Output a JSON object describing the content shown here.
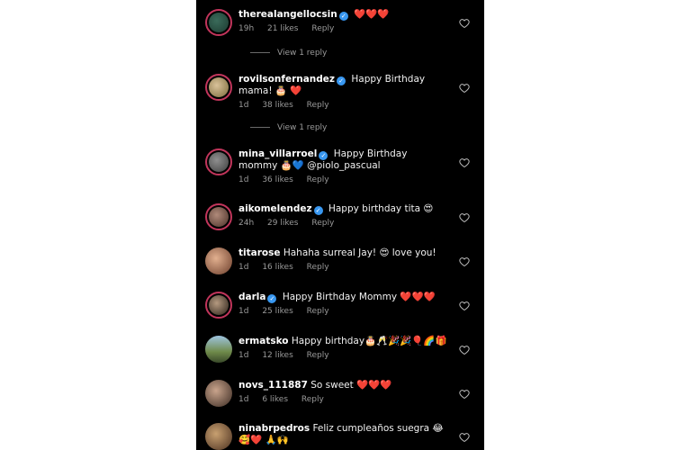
{
  "comments": [
    {
      "username": "therealangellocsin",
      "verified": true,
      "text": "❤️❤️❤️",
      "time": "19h",
      "likes": "21 likes",
      "reply": "Reply"
    },
    {
      "username": "rovilsonfernandez",
      "verified": true,
      "text": "Happy Birthday mama! 🎂 ❤️",
      "time": "1d",
      "likes": "38 likes",
      "reply": "Reply"
    },
    {
      "username": "mina_villarroel",
      "verified": true,
      "text": "Happy Birthday mommy 🎂💙 @piolo_pascual",
      "time": "1d",
      "likes": "36 likes",
      "reply": "Reply"
    },
    {
      "username": "aikomelendez",
      "verified": true,
      "text": "Happy birthday tita 😍",
      "time": "24h",
      "likes": "29 likes",
      "reply": "Reply"
    },
    {
      "username": "titarose",
      "verified": false,
      "text": "Hahaha surreal Jay! 😍 love you!",
      "time": "1d",
      "likes": "16 likes",
      "reply": "Reply"
    },
    {
      "username": "darla",
      "verified": true,
      "text": "Happy Birthday Mommy ❤️❤️❤️",
      "time": "1d",
      "likes": "25 likes",
      "reply": "Reply"
    },
    {
      "username": "ermatsko",
      "verified": false,
      "text": "Happy birthday🎂🥂🎉🎉🎈🌈🎁",
      "time": "1d",
      "likes": "12 likes",
      "reply": "Reply"
    },
    {
      "username": "novs_111887",
      "verified": false,
      "text": "So sweet ❤️❤️❤️",
      "time": "1d",
      "likes": "6 likes",
      "reply": "Reply"
    },
    {
      "username": "ninabrpedros",
      "verified": false,
      "text": "Feliz cumpleaños suegra 😂🥰❤️ 🙏🙌",
      "time": "",
      "likes": "",
      "reply": ""
    }
  ],
  "view_replies": [
    "View 1 reply",
    "View 1 reply"
  ],
  "colors": {
    "background": "#000000",
    "verified": "#3897f0",
    "ring": "#c1355b",
    "meta": "#9a9a9a"
  }
}
